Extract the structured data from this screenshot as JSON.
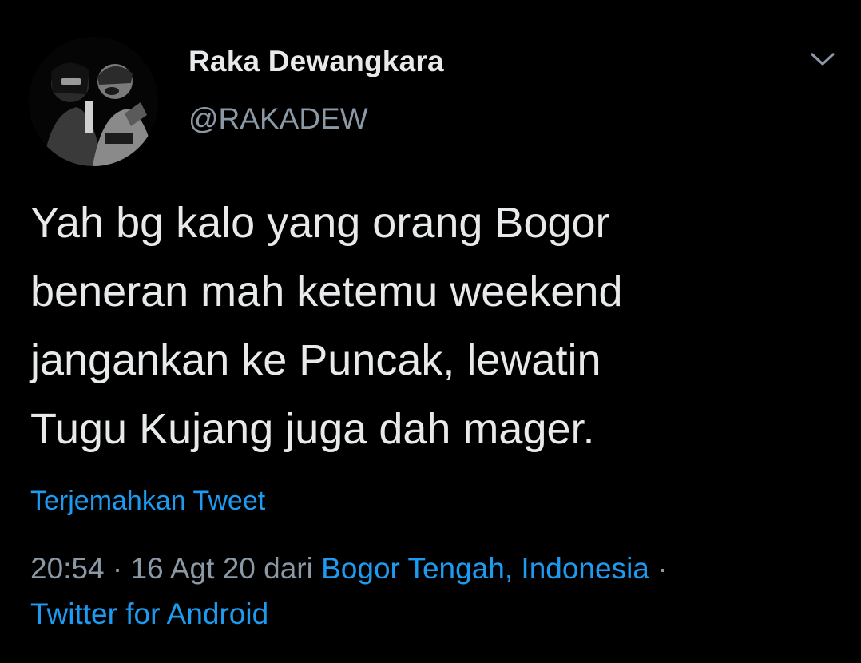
{
  "colors": {
    "background": "#000000",
    "text_primary": "#e7e9ea",
    "text_secondary": "#8b98a5",
    "accent": "#1d9bf0"
  },
  "author": {
    "name": "Raka Dewangkara",
    "handle": "@RAKADEW",
    "avatar": "avatar-photo-black-and-white"
  },
  "menu": {
    "icon": "chevron-down-icon"
  },
  "tweet": {
    "lines": [
      "Yah bg kalo yang orang Bogor",
      "beneran mah ketemu weekend",
      "jangankan ke Puncak, lewatin",
      "Tugu Kujang juga dah mager."
    ],
    "translate_label": "Terjemahkan Tweet"
  },
  "meta": {
    "time": "20:54",
    "separator": " · ",
    "date": "16 Agt 20",
    "from_label": " dari ",
    "location": "Bogor Tengah, Indonesia",
    "separator2": " · ",
    "source": "Twitter for Android"
  }
}
